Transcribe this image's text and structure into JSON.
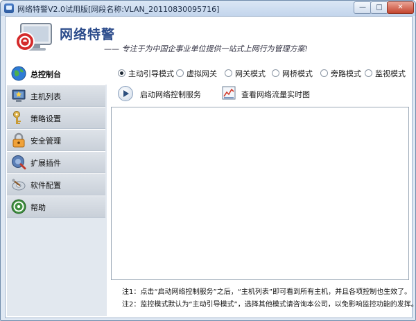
{
  "window": {
    "title": "网络特警V2.0试用版[网段名称:VLAN_20110830095716]",
    "controls": {
      "minimize": "—",
      "maximize": "□",
      "close": "✕"
    }
  },
  "banner": {
    "title": "网络特警",
    "slogan": "—— 专注于为中国企事业单位提供一站式上网行为管理方案!"
  },
  "sidebar": {
    "items": [
      {
        "label": "总控制台",
        "icon": "globe-icon",
        "active": true
      },
      {
        "label": "主机列表",
        "icon": "monitor-star-icon",
        "active": false
      },
      {
        "label": "策略设置",
        "icon": "key-icon",
        "active": false
      },
      {
        "label": "安全管理",
        "icon": "lock-icon",
        "active": false
      },
      {
        "label": "扩展插件",
        "icon": "plugin-icon",
        "active": false
      },
      {
        "label": "软件配置",
        "icon": "settings-disc-icon",
        "active": false
      },
      {
        "label": "帮助",
        "icon": "help-icon",
        "active": false
      }
    ]
  },
  "modes": {
    "selected": "主动引导模式",
    "options": [
      "主动引导模式",
      "虚拟网关",
      "网关模式",
      "网桥模式",
      "旁路模式",
      "监视模式"
    ]
  },
  "actions": {
    "start_label": "启动网络控制服务",
    "traffic_label": "查看网络流量实时图"
  },
  "notes": {
    "note1": "注1：点击“启动网络控制服务”之后，“主机列表”即可看到所有主机，并且各项控制也生效了。",
    "note2": "注2：监控模式默认为“主动引导模式”，选择其他模式请咨询本公司，以免影响监控功能的发挥。"
  },
  "colors": {
    "brand_blue": "#2a4a8a",
    "logo_red": "#d42a2a",
    "sidebar_bg": "#e2e8ef",
    "titlebar": "#c3d5ec",
    "close_red": "#c4452f"
  }
}
